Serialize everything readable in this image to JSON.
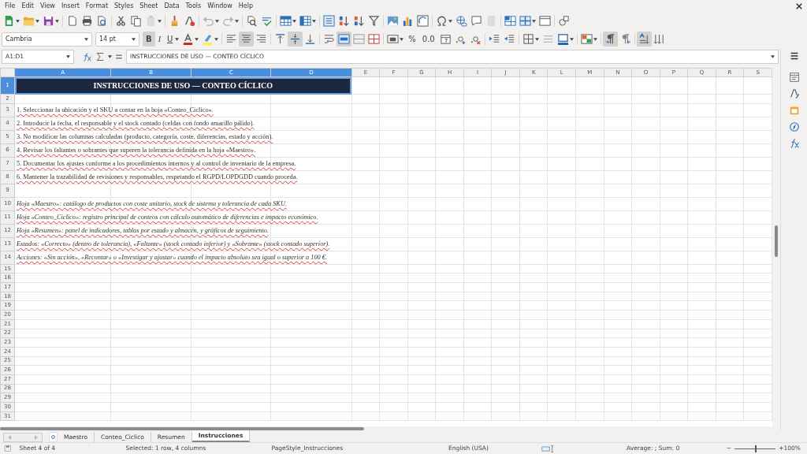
{
  "menu": [
    "File",
    "Edit",
    "View",
    "Insert",
    "Format",
    "Styles",
    "Sheet",
    "Data",
    "Tools",
    "Window",
    "Help"
  ],
  "standard_toolbar": [
    {
      "dropdown": true,
      "disabled": false
    },
    {
      "dropdown": true,
      "disabled": false
    },
    {
      "dropdown": true,
      "disabled": false
    },
    {
      "dropdown": false,
      "disabled": false
    },
    {
      "dropdown": false,
      "disabled": false
    },
    {
      "dropdown": false,
      "disabled": false
    },
    {
      "dropdown": false,
      "disabled": false
    },
    {
      "dropdown": false,
      "disabled": false
    },
    {
      "dropdown": true,
      "disabled": true
    },
    {
      "dropdown": false,
      "disabled": false
    },
    {
      "dropdown": false,
      "disabled": false
    },
    {
      "dropdown": true,
      "disabled": true
    },
    {
      "dropdown": true,
      "disabled": true
    },
    {
      "dropdown": false,
      "disabled": false
    },
    {
      "dropdown": false,
      "disabled": false
    },
    {
      "dropdown": true,
      "disabled": false
    },
    {
      "dropdown": true,
      "disabled": false
    },
    {
      "dropdown": false,
      "disabled": false
    },
    {
      "dropdown": false,
      "disabled": false
    },
    {
      "dropdown": false,
      "disabled": false
    },
    {
      "dropdown": false,
      "disabled": false
    },
    {
      "dropdown": false,
      "disabled": false
    },
    {
      "dropdown": false,
      "disabled": false
    },
    {
      "dropdown": false,
      "disabled": false
    },
    {
      "dropdown": true,
      "disabled": false
    },
    {
      "dropdown": false,
      "disabled": false
    },
    {
      "dropdown": false,
      "disabled": false
    },
    {
      "dropdown": false,
      "disabled": true
    },
    {
      "dropdown": false,
      "disabled": false
    },
    {
      "dropdown": true,
      "disabled": false
    },
    {
      "dropdown": false,
      "disabled": false
    },
    {
      "dropdown": false,
      "disabled": false
    }
  ],
  "formatting_toolbar": {
    "font": "Cambria",
    "size": "14 pt",
    "buttons": [
      {
        "label": "B",
        "pressed": true,
        "dropdown": false
      },
      {
        "label": "I",
        "pressed": false,
        "dropdown": false
      },
      {
        "label": "U",
        "pressed": false,
        "dropdown": true
      },
      {
        "pressed": false,
        "dropdown": true
      },
      {
        "pressed": false,
        "dropdown": true
      },
      {
        "pressed": false,
        "dropdown": false
      },
      {
        "pressed": true,
        "dropdown": false
      },
      {
        "pressed": false,
        "dropdown": false
      },
      {
        "pressed": false,
        "dropdown": false
      },
      {
        "pressed": true,
        "dropdown": false
      },
      {
        "pressed": false,
        "dropdown": false
      },
      {
        "pressed": false,
        "dropdown": false
      },
      {
        "pressed": true,
        "dropdown": false
      },
      {
        "pressed": false,
        "dropdown": false
      },
      {
        "pressed": false,
        "dropdown": false
      },
      {
        "pressed": false,
        "dropdown": true
      },
      {
        "label": "%",
        "pressed": false,
        "dropdown": false
      },
      {
        "label": "0.0",
        "pressed": false,
        "dropdown": false
      },
      {
        "pressed": false,
        "dropdown": false
      },
      {
        "pressed": false,
        "dropdown": false
      },
      {
        "pressed": false,
        "dropdown": false
      },
      {
        "pressed": false,
        "dropdown": false
      },
      {
        "pressed": false,
        "dropdown": false
      },
      {
        "pressed": false,
        "dropdown": true
      },
      {
        "pressed": false,
        "dropdown": false
      },
      {
        "pressed": false,
        "dropdown": true
      },
      {
        "pressed": false,
        "dropdown": true
      },
      {
        "pressed": true,
        "dropdown": false
      },
      {
        "pressed": false,
        "dropdown": false
      },
      {
        "pressed": true,
        "dropdown": false
      },
      {
        "pressed": false,
        "dropdown": false
      }
    ]
  },
  "formula_bar": {
    "name_box": "A1:D1",
    "content": "INSTRUCCIONES DE USO — CONTEO CÍCLICO"
  },
  "columns": [
    {
      "letter": "A",
      "selected": true
    },
    {
      "letter": "B",
      "selected": true
    },
    {
      "letter": "C",
      "selected": true
    },
    {
      "letter": "D",
      "selected": true
    },
    {
      "letter": "E",
      "selected": false
    },
    {
      "letter": "F",
      "selected": false
    },
    {
      "letter": "G",
      "selected": false
    },
    {
      "letter": "H",
      "selected": false
    },
    {
      "letter": "I",
      "selected": false
    },
    {
      "letter": "J",
      "selected": false
    },
    {
      "letter": "K",
      "selected": false
    },
    {
      "letter": "L",
      "selected": false
    },
    {
      "letter": "M",
      "selected": false
    },
    {
      "letter": "N",
      "selected": false
    },
    {
      "letter": "O",
      "selected": false
    },
    {
      "letter": "P",
      "selected": false
    },
    {
      "letter": "Q",
      "selected": false
    },
    {
      "letter": "R",
      "selected": false
    },
    {
      "letter": "S",
      "selected": false
    }
  ],
  "rows": [
    {
      "number": "1",
      "selected": true,
      "kind": "title",
      "text": "INSTRUCCIONES DE USO — CONTEO CÍCLICO"
    },
    {
      "number": "2",
      "selected": false,
      "kind": "empty"
    },
    {
      "number": "3",
      "selected": false,
      "kind": "step",
      "text": "1. Seleccionar la ubicación y el SKU a contar en la hoja «Conteo_Ciclico»."
    },
    {
      "number": "4",
      "selected": false,
      "kind": "step",
      "text": "2. Introducir la fecha, el responsable y el stock contado (celdas con fondo amarillo pálido)."
    },
    {
      "number": "5",
      "selected": false,
      "kind": "step",
      "text": "3. No modificar las columnas calculadas (producto, categoría, coste, diferencias, estado y acción)."
    },
    {
      "number": "6",
      "selected": false,
      "kind": "step",
      "text": "4. Revisar los faltantes o sobrantes que superen la tolerancia definida en la hoja «Maestro»."
    },
    {
      "number": "7",
      "selected": false,
      "kind": "step",
      "text": "5. Documentar los ajustes conforme a los procedimientos internos y al control de inventario de la empresa."
    },
    {
      "number": "8",
      "selected": false,
      "kind": "step",
      "text": "6. Mantener la trazabilidad de revisiones y responsables, respetando el RGPD/LOPDGDD cuando proceda."
    },
    {
      "number": "9",
      "selected": false,
      "kind": "gap"
    },
    {
      "number": "10",
      "selected": false,
      "kind": "note",
      "text": "Hoja «Maestro»: catálogo de productos con coste unitario, stock de sistema y tolerancia de cada SKU."
    },
    {
      "number": "11",
      "selected": false,
      "kind": "note",
      "text": "Hoja «Conteo_Ciclico»: registro principal de conteos con cálculo automático de diferencias e impacto económico."
    },
    {
      "number": "12",
      "selected": false,
      "kind": "note",
      "text": "Hoja «Resumen»: panel de indicadores, tablas por estado y almacén, y gráficos de seguimiento."
    },
    {
      "number": "13",
      "selected": false,
      "kind": "note",
      "text": "Estados: «Correcto» (dentro de tolerancia), «Faltante» (stock contado inferior) y «Sobrante» (stock contado superior)."
    },
    {
      "number": "14",
      "selected": false,
      "kind": "note",
      "text": "Acciones: «Sin acción», «Recontar» o «Investigar y ajustar» cuando el impacto absoluto sea igual o superior a 100 €."
    },
    {
      "number": "15",
      "selected": false,
      "kind": "empty"
    },
    {
      "number": "16",
      "selected": false,
      "kind": "empty"
    },
    {
      "number": "17",
      "selected": false,
      "kind": "empty"
    },
    {
      "number": "18",
      "selected": false,
      "kind": "empty"
    },
    {
      "number": "19",
      "selected": false,
      "kind": "empty"
    },
    {
      "number": "20",
      "selected": false,
      "kind": "empty"
    },
    {
      "number": "21",
      "selected": false,
      "kind": "empty"
    },
    {
      "number": "22",
      "selected": false,
      "kind": "empty"
    },
    {
      "number": "23",
      "selected": false,
      "kind": "empty"
    },
    {
      "number": "24",
      "selected": false,
      "kind": "empty"
    },
    {
      "number": "25",
      "selected": false,
      "kind": "empty"
    },
    {
      "number": "26",
      "selected": false,
      "kind": "empty"
    },
    {
      "number": "27",
      "selected": false,
      "kind": "empty"
    },
    {
      "number": "28",
      "selected": false,
      "kind": "empty"
    },
    {
      "number": "29",
      "selected": false,
      "kind": "empty"
    },
    {
      "number": "30",
      "selected": false,
      "kind": "empty"
    },
    {
      "number": "31",
      "selected": false,
      "kind": "empty"
    }
  ],
  "sheet_tabs": [
    {
      "label": "Maestro",
      "selected": false
    },
    {
      "label": "Conteo_Ciclico",
      "selected": false
    },
    {
      "label": "Resumen",
      "selected": false
    },
    {
      "label": "Instrucciones",
      "selected": true
    }
  ],
  "status_bar": {
    "sheet": "Sheet 4 of 4",
    "selection": "Selected: 1 row, 4 columns",
    "page_style": "PageStyle_Instrucciones",
    "language": "English (USA)",
    "summary": "Average: ; Sum: 0",
    "zoom_out": "−",
    "zoom_in": "+",
    "zoom": {
      "level": 0.5
    },
    "zoom_value": "100%"
  }
}
